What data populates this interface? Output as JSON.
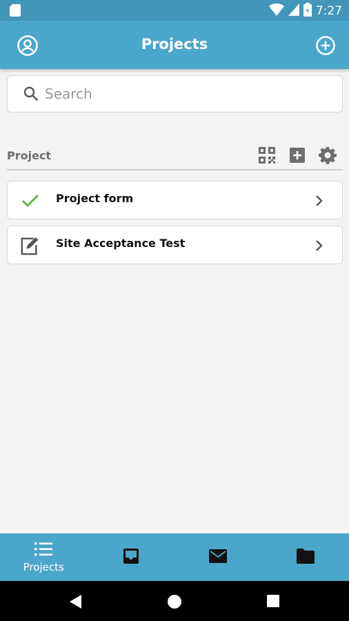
{
  "status_bar": {
    "time": "7:27"
  },
  "header": {
    "title": "Projects",
    "profile_icon": "account-circle-icon",
    "add_icon": "add-circle-icon"
  },
  "search": {
    "placeholder": "Search",
    "value": ""
  },
  "section": {
    "label": "Project",
    "tools": [
      "qr-code-icon",
      "add-box-icon",
      "gear-icon"
    ]
  },
  "projects": [
    {
      "name": "Project form",
      "status_icon": "checkmark-icon",
      "status_color": "#5fb23b"
    },
    {
      "name": "Site Acceptance Test",
      "status_icon": "edit-icon",
      "status_color": "#555555"
    }
  ],
  "bottom_nav": [
    {
      "label": "Projects",
      "icon": "list-icon"
    },
    {
      "label": "",
      "icon": "inbox-icon"
    },
    {
      "label": "",
      "icon": "mail-icon"
    },
    {
      "label": "",
      "icon": "folder-icon"
    }
  ],
  "colors": {
    "primary": "#4ba6cb",
    "status_bar": "#4296ba",
    "background": "#f3f3f3"
  }
}
